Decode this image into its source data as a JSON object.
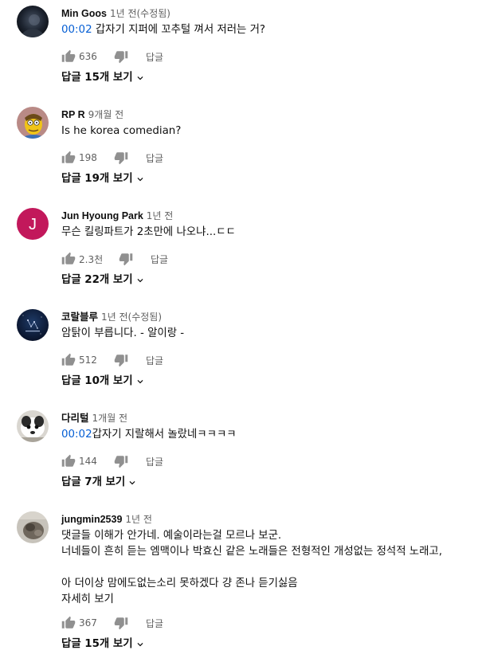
{
  "comments": [
    {
      "author": "Min Goos",
      "time": "1년 전(수정됨)",
      "timestamp": "00:02",
      "text": " 갑자기 지퍼에 꼬추털 껴서 저러는 거?",
      "likes": "636",
      "reply_label": "답글",
      "view_replies": "답글 15개 보기",
      "avatar": "dark-photo"
    },
    {
      "author": "RP R",
      "time": "9개월 전",
      "timestamp": "",
      "text": "Is he korea comedian?",
      "likes": "198",
      "reply_label": "답글",
      "view_replies": "답글 19개 보기",
      "avatar": "cartoon"
    },
    {
      "author": "Jun Hyoung Park",
      "time": "1년 전",
      "timestamp": "",
      "text": "무슨 킬링파트가 2초만에 나오냐...ㄷㄷ",
      "likes": "2.3천",
      "reply_label": "답글",
      "view_replies": "답글 22개 보기",
      "avatar": "letter",
      "avatar_letter": "J",
      "avatar_color": "#c2185b"
    },
    {
      "author": "코랄블루",
      "time": "1년 전(수정됨)",
      "timestamp": "",
      "text": "암탉이 부릅니다. - 알이랑 -",
      "likes": "512",
      "reply_label": "답글",
      "view_replies": "답글 10개 보기",
      "avatar": "night"
    },
    {
      "author": "다리털",
      "time": "1개월 전",
      "timestamp": "00:02",
      "text": "갑자기 지랄해서 놀랐네ㅋㅋㅋㅋ",
      "likes": "144",
      "reply_label": "답글",
      "view_replies": "답글 7개 보기",
      "avatar": "dog"
    },
    {
      "author": "jungmin2539",
      "time": "1년 전",
      "timestamp": "",
      "text_lines": [
        "댓글들 이해가 안가네. 예술이라는걸 모르나 보군.",
        "너네들이 흔히 듣는 엠맥이나 박효신 같은 노래들은 전형적인 개성없는 정석적 노래고,",
        "",
        "아 더이상 맘에도없는소리 못하겠다 걍 존나 듣기싫음"
      ],
      "read_more": "자세히 보기",
      "likes": "367",
      "reply_label": "답글",
      "view_replies": "답글 15개 보기",
      "avatar": "grey-photo"
    }
  ],
  "icons": {
    "like": "thumb-up-icon",
    "dislike": "thumb-down-icon",
    "expand": "chevron-down-icon"
  },
  "colors": {
    "timestamp_link": "#065fd4",
    "meta_text": "#606060",
    "icon": "#909090"
  }
}
